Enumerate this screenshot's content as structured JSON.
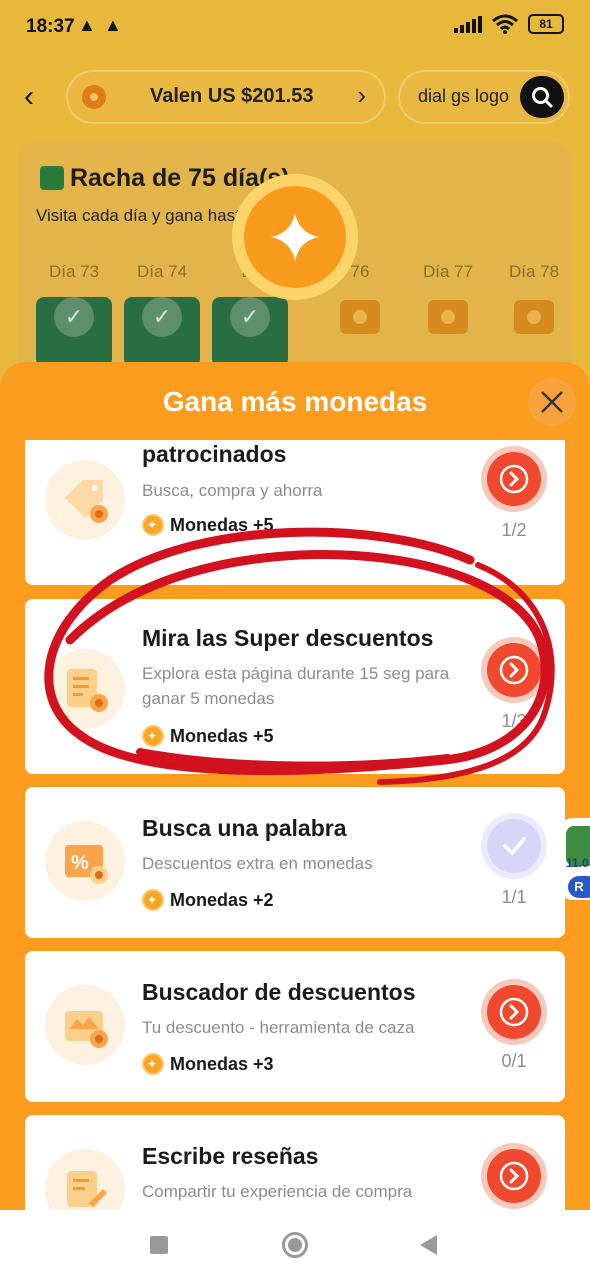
{
  "status": {
    "time": "18:37",
    "warning_icons": [
      "warning-icon",
      "warning-icon"
    ],
    "battery": "81"
  },
  "header": {
    "wallet_label": "Valen US $201.53",
    "search_value": "dial gs logo"
  },
  "streak": {
    "title": "Racha de 75 día(s)",
    "subtitle": "Visita cada día y gana hasta",
    "days": [
      {
        "label": "Día 73",
        "state": "done"
      },
      {
        "label": "Día 74",
        "state": "done"
      },
      {
        "label": "Dí",
        "state": "done"
      },
      {
        "label": "76",
        "state": "todo"
      },
      {
        "label": "Día 77",
        "state": "todo"
      },
      {
        "label": "Día 78",
        "state": "todo"
      }
    ]
  },
  "sheet": {
    "title": "Gana más monedas",
    "tasks": [
      {
        "title": "Explora artículos patrocinados",
        "description": "Busca, compra y ahorra",
        "reward": "Monedas +5",
        "progress": "1/2",
        "state": "go",
        "icon": "tag-icon"
      },
      {
        "title": "Mira las Super descuentos",
        "description": "Explora esta página durante 15 seg para ganar 5 monedas",
        "reward": "Monedas +5",
        "progress": "1/3",
        "state": "go",
        "icon": "document-icon"
      },
      {
        "title": "Busca una palabra",
        "description": "Descuentos extra en monedas",
        "reward": "Monedas +2",
        "progress": "1/1",
        "state": "done",
        "icon": "discount-box-icon"
      },
      {
        "title": "Buscador de descuentos",
        "description": "Tu descuento - herramienta de caza",
        "reward": "Monedas +3",
        "progress": "0/1",
        "state": "go",
        "icon": "shop-icon"
      },
      {
        "title": "Escribe reseñas",
        "description": "Compartir tu experiencia de compra",
        "reward": "",
        "progress": "",
        "state": "go",
        "icon": "review-icon"
      }
    ]
  },
  "side_float": {
    "text_top": "11.0",
    "text_bottom": "R"
  },
  "colors": {
    "sheet_orange": "#fb9c1e",
    "go_red": "#f0492f",
    "done_lavender": "#d7d6f8",
    "scribble_red": "#d2131f"
  }
}
